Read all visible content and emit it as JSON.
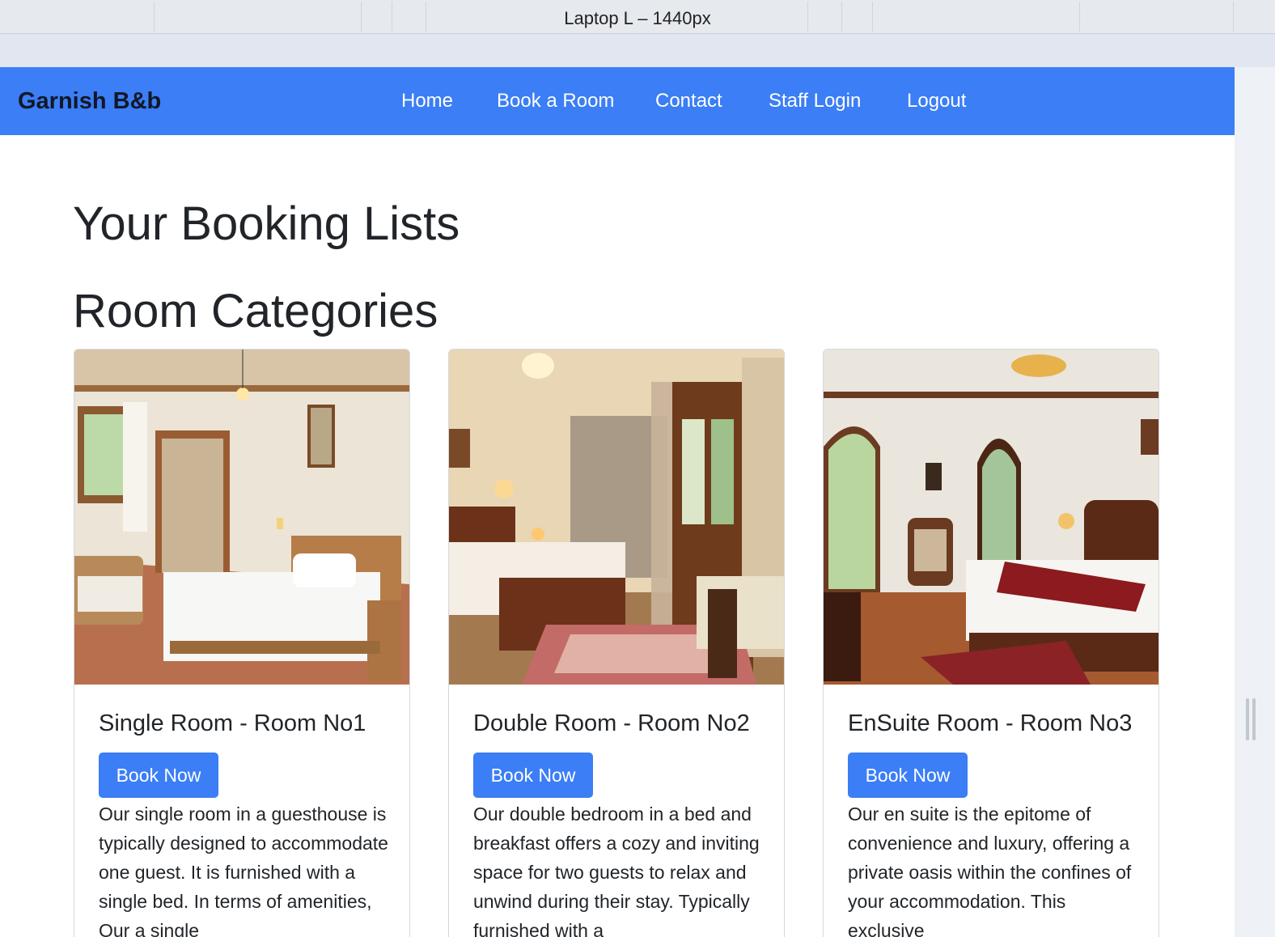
{
  "devtools": {
    "viewport_label": "Laptop L – 1440px"
  },
  "navbar": {
    "brand": "Garnish B&b",
    "links": [
      "Home",
      "Book a Room",
      "Contact",
      "Staff Login",
      "Logout"
    ]
  },
  "main": {
    "heading": "Your Booking Lists",
    "subheading": "Room Categories"
  },
  "rooms": [
    {
      "title": "Single Room - Room No1",
      "button": "Book Now",
      "description": "Our single room in a guesthouse is typically designed to accommodate one guest. It is furnished with a single bed. In terms of amenities, Our a single"
    },
    {
      "title": "Double Room - Room No2",
      "button": "Book Now",
      "description": "Our double bedroom in a bed and breakfast offers a cozy and inviting space for two guests to relax and unwind during their stay. Typically furnished with a"
    },
    {
      "title": "EnSuite Room - Room No3",
      "button": "Book Now",
      "description": "Our en suite is the epitome of convenience and luxury, offering a private oasis within the confines of your accommodation. This exclusive"
    }
  ],
  "colors": {
    "primary": "#3b7ef5",
    "brand_text": "#111827",
    "body_text": "#212529"
  }
}
